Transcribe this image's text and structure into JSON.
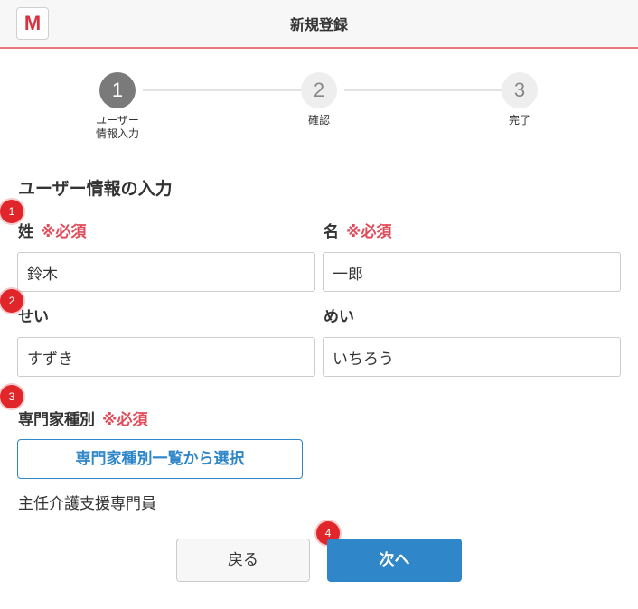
{
  "header": {
    "logo": "M",
    "title": "新規登録"
  },
  "stepper": {
    "steps": [
      {
        "number": "1",
        "label": "ユーザー\n情報入力",
        "active": true
      },
      {
        "number": "2",
        "label": "確認",
        "active": false
      },
      {
        "number": "3",
        "label": "完了",
        "active": false
      }
    ]
  },
  "form": {
    "section_title": "ユーザー情報の入力",
    "required_mark": "※必須",
    "last_name": {
      "label": "姓",
      "value": "鈴木"
    },
    "first_name": {
      "label": "名",
      "value": "一郎"
    },
    "last_name_kana": {
      "label": "せい",
      "value": "すずき"
    },
    "first_name_kana": {
      "label": "めい",
      "value": "いちろう"
    },
    "specialty": {
      "label": "専門家種別",
      "select_button": "専門家種別一覧から選択",
      "selected": "主任介護支援専門員"
    }
  },
  "actions": {
    "back_label": "戻る",
    "next_label": "次へ"
  },
  "annotations": [
    "1",
    "2",
    "3",
    "4"
  ],
  "colors": {
    "accent": "#2f86c8",
    "required": "#e04b5a",
    "header_border": "#e87878",
    "badge": "#e0262b"
  }
}
